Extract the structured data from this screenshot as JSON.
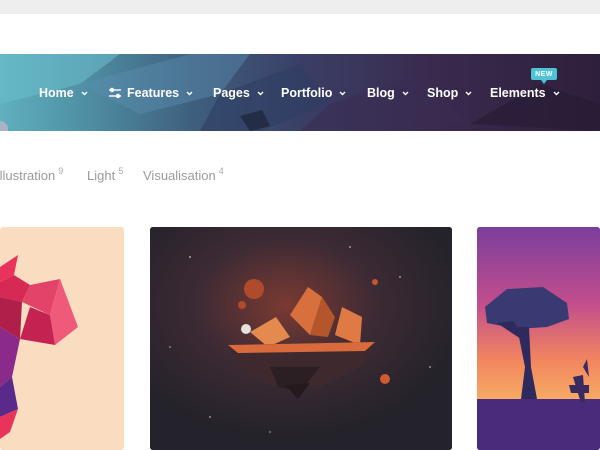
{
  "nav": {
    "items": [
      {
        "label": "Home",
        "has_dropdown": true
      },
      {
        "label": "Features",
        "has_dropdown": true,
        "icon": "sliders-icon"
      },
      {
        "label": "Pages",
        "has_dropdown": true
      },
      {
        "label": "Portfolio",
        "has_dropdown": true
      },
      {
        "label": "Blog",
        "has_dropdown": true
      },
      {
        "label": "Shop",
        "has_dropdown": true
      },
      {
        "label": "Elements",
        "has_dropdown": true,
        "badge": "NEW"
      }
    ]
  },
  "filters": [
    {
      "label": "Illustration",
      "count": "9"
    },
    {
      "label": "Light",
      "count": "5"
    },
    {
      "label": "Visualisation",
      "count": "4"
    }
  ],
  "portfolio": {
    "items": [
      {
        "name": "low-poly-figure"
      },
      {
        "name": "floating-island"
      },
      {
        "name": "tree-and-deer"
      }
    ]
  },
  "colors": {
    "nav_text": "#ffffff",
    "badge": "#4fc3d6",
    "filter_text": "#9a9a9a"
  }
}
